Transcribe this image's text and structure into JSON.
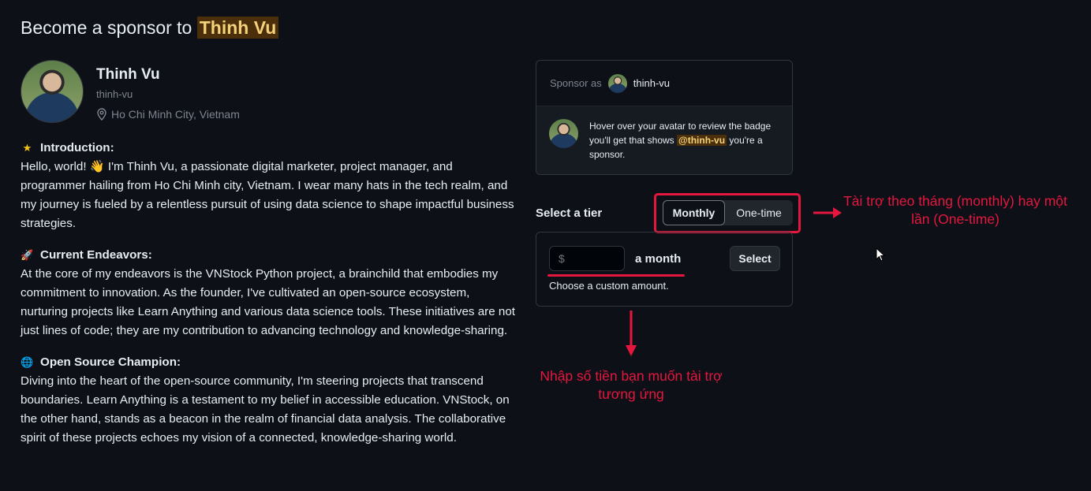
{
  "header": {
    "title_prefix": "Become a sponsor to",
    "title_name": "Thinh Vu"
  },
  "profile": {
    "name": "Thinh Vu",
    "login": "thinh-vu",
    "location": "Ho Chi Minh City, Vietnam"
  },
  "bio": {
    "sections": [
      {
        "emoji": "★",
        "title": "Introduction:",
        "text": "Hello, world! 👋 I'm Thinh Vu, a passionate digital marketer, project manager, and programmer hailing from Ho Chi Minh city, Vietnam. I wear many hats in the tech realm, and my journey is fueled by a relentless pursuit of using data science to shape impactful business strategies."
      },
      {
        "emoji": "🚀",
        "title": "Current Endeavors:",
        "text": "At the core of my endeavors is the VNStock Python project, a brainchild that embodies my commitment to innovation. As the founder, I've cultivated an open-source ecosystem, nurturing projects like Learn Anything and various data science tools. These initiatives are not just lines of code; they are my contribution to advancing technology and knowledge-sharing."
      },
      {
        "emoji": "🌐",
        "title": "Open Source Champion:",
        "text": "Diving into the heart of the open-source community, I'm steering projects that transcend boundaries. Learn Anything is a testament to my belief in accessible education. VNStock, on the other hand, stands as a beacon in the realm of financial data analysis. The collaborative spirit of these projects echoes my vision of a connected, knowledge-sharing world."
      }
    ]
  },
  "sponsor_card": {
    "sponsor_as_label": "Sponsor as",
    "sponsor_login": "thinh-vu",
    "hint_before": "Hover over your avatar to review the badge you'll get that shows",
    "hint_mention": "@thinh-vu",
    "hint_after": "you're a sponsor."
  },
  "tier": {
    "label": "Select a tier",
    "options": [
      "Monthly",
      "One-time"
    ],
    "selected": "Monthly"
  },
  "amount": {
    "placeholder": "$",
    "value": "",
    "unit_label": "a month",
    "select_label": "Select",
    "hint": "Choose a custom amount."
  },
  "annotations": {
    "tier_note": "Tài trợ theo tháng (monthly) hay một lần (One-time)",
    "amount_note": "Nhập số tiền bạn muốn tài trợ tương ứng",
    "color": "#e5173f"
  }
}
